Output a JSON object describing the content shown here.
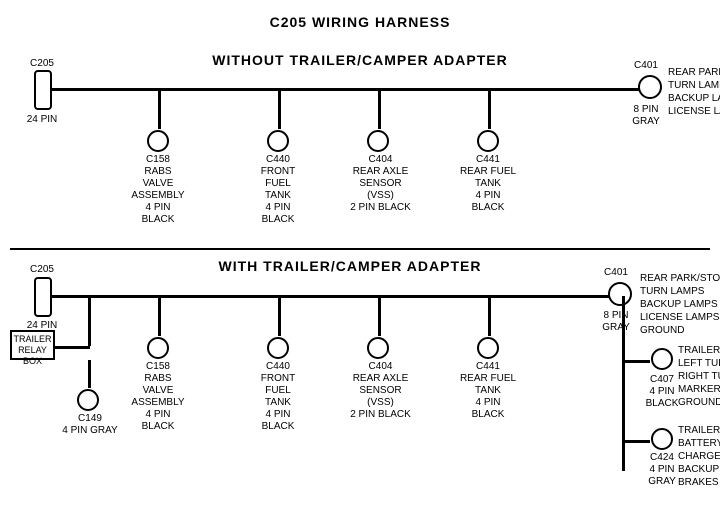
{
  "title": "C205 WIRING HARNESS",
  "top_section": {
    "label": "WITHOUT  TRAILER/CAMPER  ADAPTER",
    "left_connector": {
      "name": "C205",
      "pin_label": "24 PIN"
    },
    "right_connector": {
      "name": "C401",
      "pin_label": "8 PIN\nGRAY",
      "side_label": "REAR PARK/STOP\nTURN LAMPS\nBACKUP LAMPS\nLICENSE LAMPS"
    },
    "connectors": [
      {
        "id": "C158",
        "label": "C158\nRABS VALVE\nASSEMBLY\n4 PIN BLACK"
      },
      {
        "id": "C440",
        "label": "C440\nFRONT FUEL\nTANK\n4 PIN BLACK"
      },
      {
        "id": "C404",
        "label": "C404\nREAR AXLE\nSENSOR\n(VSS)\n2 PIN BLACK"
      },
      {
        "id": "C441",
        "label": "C441\nREAR FUEL\nTANK\n4 PIN BLACK"
      }
    ]
  },
  "bottom_section": {
    "label": "WITH  TRAILER/CAMPER  ADAPTER",
    "left_connector": {
      "name": "C205",
      "pin_label": "24 PIN"
    },
    "right_connector": {
      "name": "C401",
      "pin_label": "8 PIN\nGRAY",
      "side_label": "REAR PARK/STOP\nTURN LAMPS\nBACKUP LAMPS\nLICENSE LAMPS\nGROUND"
    },
    "connectors": [
      {
        "id": "C158",
        "label": "C158\nRABS VALVE\nASSEMBLY\n4 PIN BLACK"
      },
      {
        "id": "C440",
        "label": "C440\nFRONT FUEL\nTANK\n4 PIN BLACK"
      },
      {
        "id": "C404",
        "label": "C404\nREAR AXLE\nSENSOR\n(VSS)\n2 PIN BLACK"
      },
      {
        "id": "C441",
        "label": "C441\nREAR FUEL\nTANK\n4 PIN BLACK"
      }
    ],
    "extra_left": {
      "box_label": "TRAILER\nRELAY\nBOX",
      "connector_label": "C149\n4 PIN GRAY"
    },
    "extra_right_1": {
      "name": "C407",
      "pin_label": "4 PIN\nBLACK",
      "side_label": "TRAILER WIRES\nLEFT TURN\nRIGHT TURN\nMARKER\nGROUND"
    },
    "extra_right_2": {
      "name": "C424",
      "pin_label": "4 PIN\nGRAY",
      "side_label": "TRAILER WIRES\nBATTERY CHARGE\nBACKUP\nBRAKES"
    }
  }
}
